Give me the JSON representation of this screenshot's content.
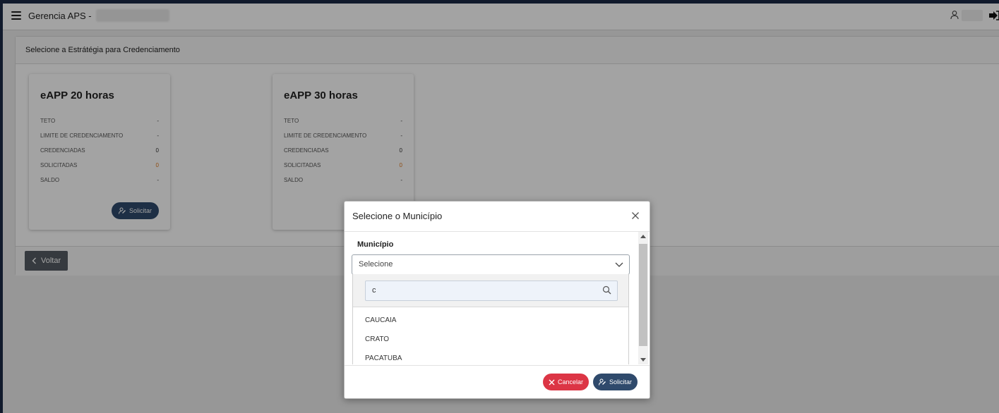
{
  "header": {
    "app_title": "Gerencia APS -",
    "icons": [
      "menu-icon",
      "user-icon",
      "logout-icon"
    ]
  },
  "panel": {
    "title": "Selecione a Estrátégia para Credenciamento",
    "cards": [
      {
        "title": "eAPP 20 horas",
        "rows": [
          {
            "label": "TETO",
            "value": "-"
          },
          {
            "label": "LIMITE DE CREDENCIAMENTO",
            "value": "-"
          },
          {
            "label": "CREDENCIADAS",
            "value": "0"
          },
          {
            "label": "SOLICITADAS",
            "value": "0"
          },
          {
            "label": "SALDO",
            "value": "-"
          }
        ],
        "button_label": "Solicitar"
      },
      {
        "title": "eAPP 30 horas",
        "rows": [
          {
            "label": "TETO",
            "value": "-"
          },
          {
            "label": "LIMITE DE CREDENCIAMENTO",
            "value": "-"
          },
          {
            "label": "CREDENCIADAS",
            "value": "0"
          },
          {
            "label": "SOLICITADAS",
            "value": "0"
          },
          {
            "label": "SALDO",
            "value": "-"
          }
        ]
      }
    ],
    "back_label": "Voltar"
  },
  "modal": {
    "title": "Selecione o Município",
    "field_label": "Município",
    "select_placeholder": "Selecione",
    "search_value": "c",
    "options": [
      "CAUCAIA",
      "CRATO",
      "PACATUBA"
    ],
    "cancel_label": "Cancelar",
    "submit_label": "Solicitar"
  },
  "colors": {
    "primary": "#2f4a6c",
    "danger": "#dc3545",
    "highlight": "#e07b1f",
    "back_button": "#555c63"
  }
}
